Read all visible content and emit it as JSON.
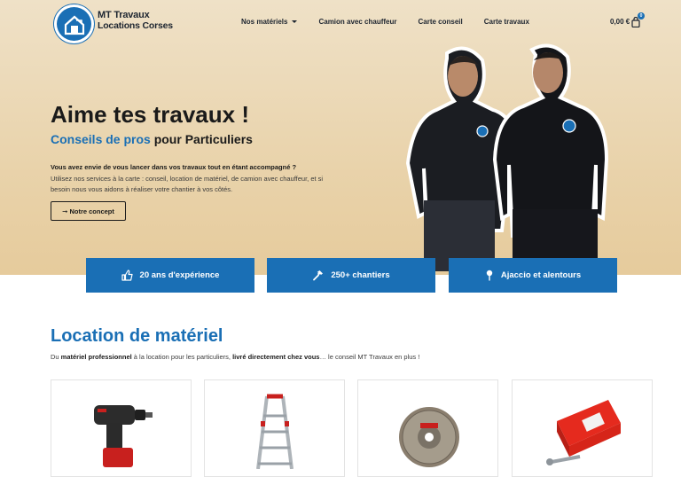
{
  "header": {
    "brand_line1": "MT Travaux",
    "brand_line2": "Locations Corses",
    "nav": [
      "Nos matériels",
      "Camion avec chauffeur",
      "Carte conseil",
      "Carte travaux"
    ],
    "cart_total": "0,00 €",
    "cart_count": "0"
  },
  "hero": {
    "title": "Aime tes travaux !",
    "subtitle_accent": "Conseils de pros",
    "subtitle_rest": " pour Particuliers",
    "intro_bold": "Vous avez envie de vous lancer dans vos travaux tout en étant accompagné ?",
    "intro_text": "Utilisez nos services à la carte : conseil, location de matériel, de camion avec chauffeur, et si besoin nous vous aidons à réaliser votre chantier à vos côtés.",
    "cta": "➞ Notre concept"
  },
  "features": [
    {
      "label": "20 ans d'expérience",
      "icon": "thumbs-up-icon"
    },
    {
      "label": "250+ chantiers",
      "icon": "hammer-icon"
    },
    {
      "label": "Ajaccio et alentours",
      "icon": "map-pin-icon"
    }
  ],
  "rental": {
    "title": "Location de matériel",
    "desc_1": "Du ",
    "desc_b1": "matériel professionnel",
    "desc_2": " à la location pour les particuliers, ",
    "desc_b2": "livré directement chez vous",
    "desc_3": "… le conseil MT Travaux en plus !",
    "products": [
      "drill-image",
      "ladder-image",
      "saw-blade-image",
      "screws-box-image"
    ]
  },
  "colors": {
    "accent": "#1a6fb5",
    "hero_bg": "#e9d3ab"
  }
}
